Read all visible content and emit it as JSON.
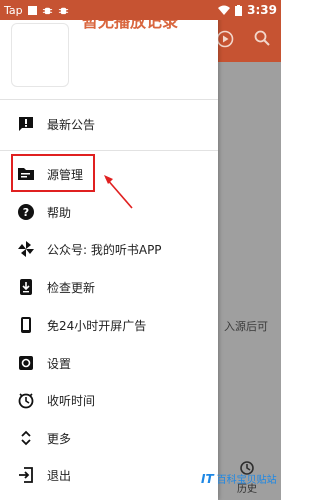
{
  "status_bar": {
    "left_label": "Tap",
    "time": "3:39"
  },
  "header": {
    "now_playing": "暂无播放记录"
  },
  "menu": [
    {
      "label": "最新公告",
      "icon": "announcement-icon"
    },
    {
      "label": "源管理",
      "icon": "source-folder-icon"
    },
    {
      "label": "帮助",
      "icon": "help-icon"
    },
    {
      "label": "公众号: 我的听书APP",
      "icon": "pinwheel-icon"
    },
    {
      "label": "检查更新",
      "icon": "update-download-icon"
    },
    {
      "label": "免24小时开屏广告",
      "icon": "phone-icon"
    },
    {
      "label": "设置",
      "icon": "settings-icon"
    },
    {
      "label": "收听时间",
      "icon": "timer-icon"
    },
    {
      "label": "更多",
      "icon": "expand-more-icon"
    },
    {
      "label": "退出",
      "icon": "exit-icon"
    }
  ],
  "background": {
    "hint_text": "入源后可",
    "tab_history": "历史"
  },
  "watermark": {
    "logo": "IT",
    "text": "百科宝贝贴站"
  },
  "colors": {
    "accent": "#c65332",
    "highlight": "#e02020"
  }
}
